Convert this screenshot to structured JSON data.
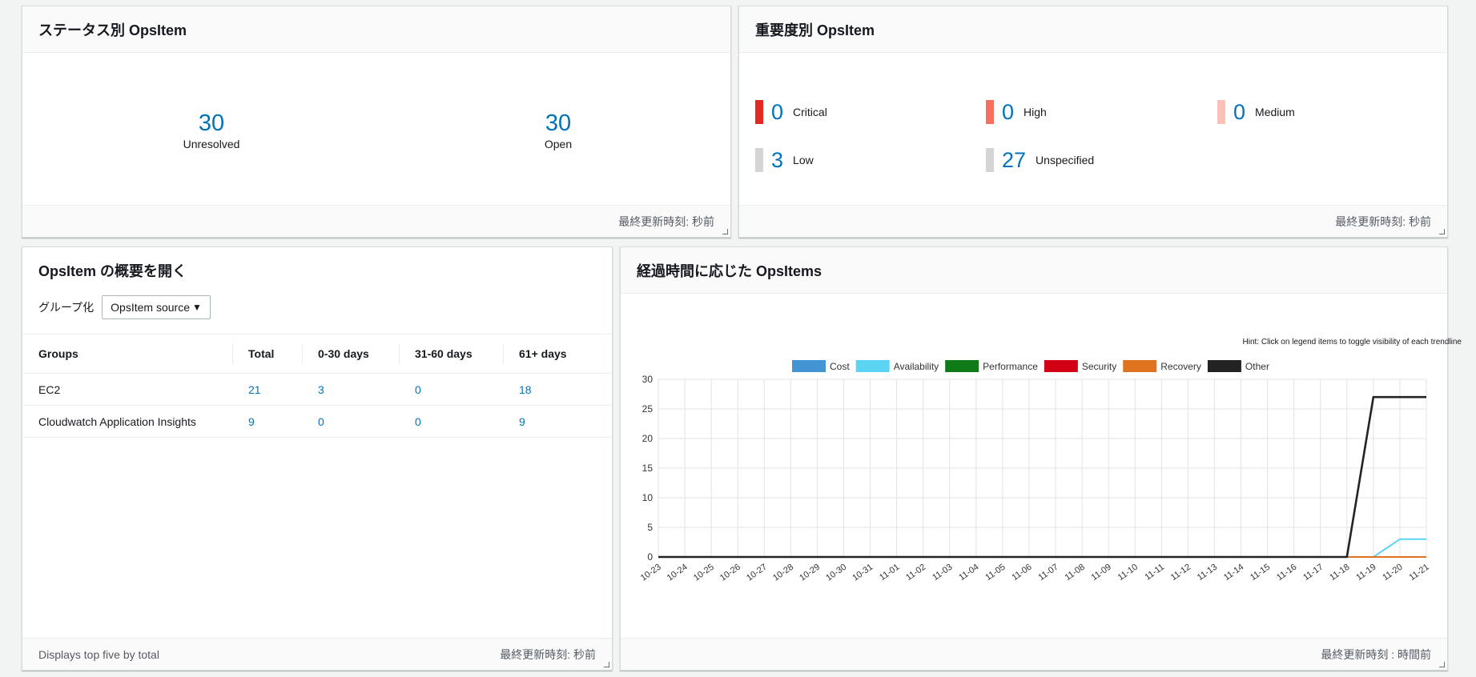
{
  "status_panel": {
    "title": "ステータス別 OpsItem",
    "items": [
      {
        "value": "30",
        "label": "Unresolved"
      },
      {
        "value": "30",
        "label": "Open"
      }
    ],
    "footer": "最終更新時刻: 秒前"
  },
  "severity_panel": {
    "title": "重要度別 OpsItem",
    "items": [
      {
        "value": "0",
        "label": "Critical",
        "color": "#e02b23"
      },
      {
        "value": "0",
        "label": "High",
        "color": "#f86f5e"
      },
      {
        "value": "0",
        "label": "Medium",
        "color": "#fbc0b7"
      },
      {
        "value": "3",
        "label": "Low",
        "color": "#d5d5d5"
      },
      {
        "value": "27",
        "label": "Unspecified",
        "color": "#d5d5d5"
      }
    ],
    "footer": "最終更新時刻: 秒前"
  },
  "summary_panel": {
    "title": "OpsItem の概要を開く",
    "group_label": "グループ化",
    "group_select": "OpsItem source",
    "columns": [
      "Groups",
      "Total",
      "0-30 days",
      "31-60 days",
      "61+ days"
    ],
    "rows": [
      {
        "group": "EC2",
        "total": "21",
        "d0_30": "3",
        "d31_60": "0",
        "d61": "18"
      },
      {
        "group": "Cloudwatch Application Insights",
        "total": "9",
        "d0_30": "0",
        "d31_60": "0",
        "d61": "9"
      }
    ],
    "footer_left": "Displays top five by total",
    "footer_right": "最終更新時刻: 秒前"
  },
  "time_panel": {
    "title": "経過時間に応じた OpsItems",
    "hint": "Hint: Click on legend items to toggle visibility of each trendline",
    "footer": "最終更新時刻 : 時間前"
  },
  "chart_data": {
    "type": "line",
    "title": "",
    "xlabel": "",
    "ylabel": "",
    "ylim": [
      0,
      30
    ],
    "yticks": [
      0,
      5,
      10,
      15,
      20,
      25,
      30
    ],
    "grid": true,
    "legend": "top-center",
    "x": [
      "10-23",
      "10-24",
      "10-25",
      "10-26",
      "10-27",
      "10-28",
      "10-29",
      "10-30",
      "10-31",
      "11-01",
      "11-02",
      "11-03",
      "11-04",
      "11-05",
      "11-06",
      "11-07",
      "11-08",
      "11-09",
      "11-10",
      "11-11",
      "11-12",
      "11-13",
      "11-14",
      "11-15",
      "11-16",
      "11-17",
      "11-18",
      "11-19",
      "11-20",
      "11-21"
    ],
    "series": [
      {
        "name": "Cost",
        "color": "#4394d2",
        "values": [
          0,
          0,
          0,
          0,
          0,
          0,
          0,
          0,
          0,
          0,
          0,
          0,
          0,
          0,
          0,
          0,
          0,
          0,
          0,
          0,
          0,
          0,
          0,
          0,
          0,
          0,
          0,
          0,
          0,
          0
        ]
      },
      {
        "name": "Availability",
        "color": "#5bd4f4",
        "values": [
          0,
          0,
          0,
          0,
          0,
          0,
          0,
          0,
          0,
          0,
          0,
          0,
          0,
          0,
          0,
          0,
          0,
          0,
          0,
          0,
          0,
          0,
          0,
          0,
          0,
          0,
          0,
          0,
          3,
          3
        ]
      },
      {
        "name": "Performance",
        "color": "#0f7b18",
        "values": [
          0,
          0,
          0,
          0,
          0,
          0,
          0,
          0,
          0,
          0,
          0,
          0,
          0,
          0,
          0,
          0,
          0,
          0,
          0,
          0,
          0,
          0,
          0,
          0,
          0,
          0,
          0,
          0,
          0,
          0
        ]
      },
      {
        "name": "Security",
        "color": "#d20015",
        "values": [
          0,
          0,
          0,
          0,
          0,
          0,
          0,
          0,
          0,
          0,
          0,
          0,
          0,
          0,
          0,
          0,
          0,
          0,
          0,
          0,
          0,
          0,
          0,
          0,
          0,
          0,
          0,
          0,
          0,
          0
        ]
      },
      {
        "name": "Recovery",
        "color": "#e0731f",
        "values": [
          0,
          0,
          0,
          0,
          0,
          0,
          0,
          0,
          0,
          0,
          0,
          0,
          0,
          0,
          0,
          0,
          0,
          0,
          0,
          0,
          0,
          0,
          0,
          0,
          0,
          0,
          0,
          0,
          0,
          0
        ]
      },
      {
        "name": "Other",
        "color": "#232323",
        "values": [
          0,
          0,
          0,
          0,
          0,
          0,
          0,
          0,
          0,
          0,
          0,
          0,
          0,
          0,
          0,
          0,
          0,
          0,
          0,
          0,
          0,
          0,
          0,
          0,
          0,
          0,
          0,
          27,
          27,
          27
        ]
      }
    ]
  }
}
